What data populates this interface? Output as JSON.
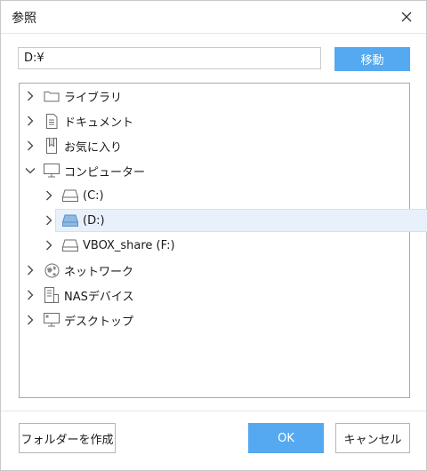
{
  "dialog": {
    "title": "参照"
  },
  "path": {
    "value": "D:¥"
  },
  "buttons": {
    "move": "移動",
    "new_folder": "フォルダーを作成",
    "ok": "OK",
    "cancel": "キャンセル"
  },
  "colors": {
    "accent": "#54a9f0",
    "selection": "#e8f1fb",
    "icon": "#666666",
    "drive_selected": "#8fb8e3"
  },
  "tree": {
    "items": [
      {
        "label": "ライブラリ",
        "icon": "folder-icon"
      },
      {
        "label": "ドキュメント",
        "icon": "document-icon"
      },
      {
        "label": "お気に入り",
        "icon": "favorites-icon"
      },
      {
        "label": "コンピューター",
        "icon": "computer-icon",
        "expanded": true
      },
      {
        "label": "(C:)",
        "icon": "drive-icon"
      },
      {
        "label": "(D:)",
        "icon": "drive-icon",
        "selected": true
      },
      {
        "label": "VBOX_share (F:)",
        "icon": "drive-icon"
      },
      {
        "label": "ネットワーク",
        "icon": "network-icon"
      },
      {
        "label": "NASデバイス",
        "icon": "nas-icon"
      },
      {
        "label": "デスクトップ",
        "icon": "desktop-icon"
      }
    ]
  }
}
